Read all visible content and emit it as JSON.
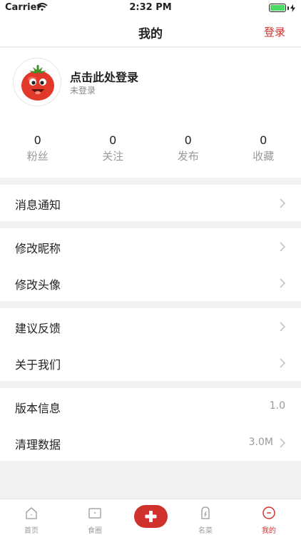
{
  "status_bar": {
    "carrier": "Carrier",
    "time": "2:32 PM",
    "battery_level": 1.0
  },
  "nav": {
    "title": "我的",
    "login_label": "登录"
  },
  "profile": {
    "name": "点击此处登录",
    "status": "未登录"
  },
  "stats": [
    {
      "value": "0",
      "label": "粉丝"
    },
    {
      "value": "0",
      "label": "关注"
    },
    {
      "value": "0",
      "label": "发布"
    },
    {
      "value": "0",
      "label": "收藏"
    }
  ],
  "menu": {
    "notifications": "消息通知",
    "edit_nickname": "修改昵称",
    "edit_avatar": "修改头像",
    "feedback": "建议反馈",
    "about": "关于我们",
    "version_label": "版本信息",
    "version_value": "1.0",
    "clear_label": "清理数据",
    "clear_value": "3.0M"
  },
  "tabs": [
    {
      "label": "首页",
      "icon": "home-icon",
      "active": false
    },
    {
      "label": "食圈",
      "icon": "monitor-icon",
      "active": false
    },
    {
      "label": "",
      "icon": "plus-icon",
      "active": false
    },
    {
      "label": "名菜",
      "icon": "dish-icon",
      "active": false
    },
    {
      "label": "我的",
      "icon": "profile-icon",
      "active": true
    }
  ],
  "colors": {
    "accent": "#d0312d",
    "battery": "#4cd964",
    "background": "#f2f2f2"
  }
}
